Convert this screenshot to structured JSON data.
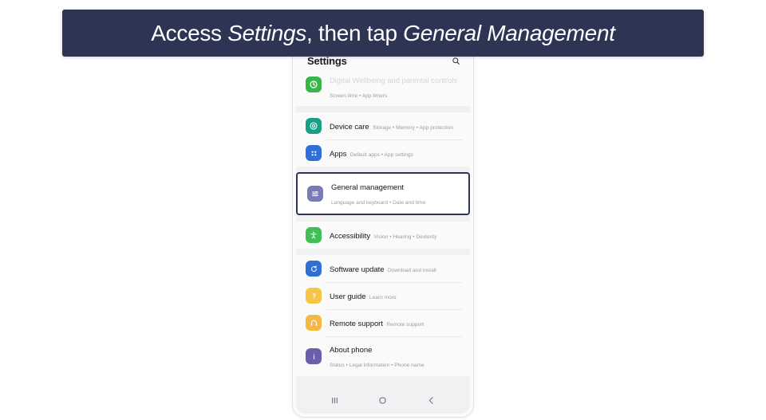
{
  "caption": {
    "part1": "Access ",
    "em1": "Settings",
    "part2": ", then tap ",
    "em2": "General Management"
  },
  "phone": {
    "header": {
      "title": "Settings",
      "search_icon": "search-icon"
    },
    "groups": [
      {
        "rows": [
          {
            "title": "Digital Wellbeing and parental controls",
            "subtitle": "Screen time  •  App timers",
            "icon": "digital-wellbeing-icon",
            "icon_color": "#3ab54a",
            "partial": true
          }
        ]
      },
      {
        "rows": [
          {
            "title": "Device care",
            "subtitle": "Storage  •  Memory  •  App protection",
            "icon": "device-care-icon",
            "icon_color": "#16a085"
          },
          {
            "title": "Apps",
            "subtitle": "Default apps  •  App settings",
            "icon": "apps-icon",
            "icon_color": "#2f6fd8"
          }
        ]
      },
      {
        "highlighted": true,
        "rows": [
          {
            "title": "General management",
            "subtitle": "Language and keyboard  •  Date and time",
            "icon": "general-management-icon",
            "icon_color": "#7a7ab5"
          }
        ]
      },
      {
        "rows": [
          {
            "title": "Accessibility",
            "subtitle": "Vision  •  Hearing  •  Dexterity",
            "icon": "accessibility-icon",
            "icon_color": "#3fbf54"
          }
        ]
      },
      {
        "rows": [
          {
            "title": "Software update",
            "subtitle": "Download and install",
            "icon": "software-update-icon",
            "icon_color": "#2f6fd8"
          },
          {
            "title": "User guide",
            "subtitle": "Learn more",
            "icon": "user-guide-icon",
            "icon_color": "#f5c646"
          },
          {
            "title": "Remote support",
            "subtitle": "Remote support",
            "icon": "remote-support-icon",
            "icon_color": "#f5b840"
          },
          {
            "title": "About phone",
            "subtitle": "Status  •  Legal information  •  Phone name",
            "icon": "about-phone-icon",
            "icon_color": "#6a5fa8"
          }
        ]
      }
    ],
    "nav_bar": {
      "recents": "recents-icon",
      "home": "home-icon",
      "back": "back-icon"
    }
  },
  "colors": {
    "banner_bg": "#2e3454",
    "highlight_border": "#2e3456",
    "page_bg": "#ffffff"
  }
}
